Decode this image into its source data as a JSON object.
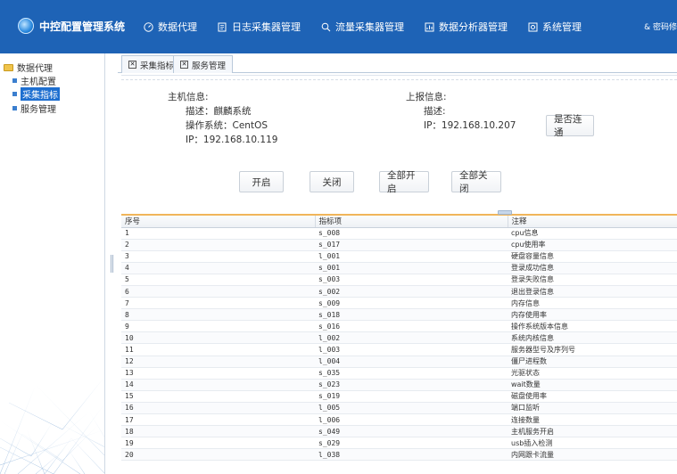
{
  "header": {
    "title": "中控配置管理系统",
    "nav": [
      {
        "label": "数据代理",
        "icon": "gauge-icon"
      },
      {
        "label": "日志采集器管理",
        "icon": "log-icon"
      },
      {
        "label": "流量采集器管理",
        "icon": "search-icon"
      },
      {
        "label": "数据分析器管理",
        "icon": "chart-icon"
      },
      {
        "label": "系统管理",
        "icon": "gear-icon"
      }
    ],
    "user": "& 密码修"
  },
  "sidebar": {
    "root": "数据代理",
    "items": [
      {
        "label": "主机配置"
      },
      {
        "label": "采集指标"
      },
      {
        "label": "服务管理"
      }
    ]
  },
  "tabs": [
    {
      "label": "采集指标"
    },
    {
      "label": "服务管理"
    }
  ],
  "host_info": {
    "heading": "主机信息:",
    "desc": "描述：麒麟系统",
    "os": "操作系统：CentOS",
    "ip": "IP：192.168.10.119"
  },
  "report_info": {
    "heading": "上报信息:",
    "desc": "描述:",
    "ip": "IP：192.168.10.207",
    "check_button": "是否连通"
  },
  "actions": {
    "start": "开启",
    "stop": "关闭",
    "start_all": "全部开启",
    "stop_all": "全部关闭"
  },
  "table": {
    "columns": [
      "序号",
      "指标项",
      "注释"
    ],
    "rows": [
      [
        "1",
        "s_008",
        "cpu信息"
      ],
      [
        "2",
        "s_017",
        "cpu使用率"
      ],
      [
        "3",
        "l_001",
        "硬盘容量信息"
      ],
      [
        "4",
        "s_001",
        "登录成功信息"
      ],
      [
        "5",
        "s_003",
        "登录失败信息"
      ],
      [
        "6",
        "s_002",
        "退出登录信息"
      ],
      [
        "7",
        "s_009",
        "内存信息"
      ],
      [
        "8",
        "s_018",
        "内存使用率"
      ],
      [
        "9",
        "s_016",
        "操作系统版本信息"
      ],
      [
        "10",
        "l_002",
        "系统内核信息"
      ],
      [
        "11",
        "l_003",
        "服务器型号及序列号"
      ],
      [
        "12",
        "l_004",
        "僵尸进程数"
      ],
      [
        "13",
        "s_035",
        "光驱状态"
      ],
      [
        "14",
        "s_023",
        "wait数量"
      ],
      [
        "15",
        "s_019",
        "磁盘使用率"
      ],
      [
        "16",
        "l_005",
        "端口监听"
      ],
      [
        "17",
        "l_006",
        "连接数量"
      ],
      [
        "18",
        "s_049",
        "主机服务开启"
      ],
      [
        "19",
        "s_029",
        "usb插入检测"
      ],
      [
        "20",
        "l_038",
        "内网跟卡流量"
      ]
    ]
  }
}
